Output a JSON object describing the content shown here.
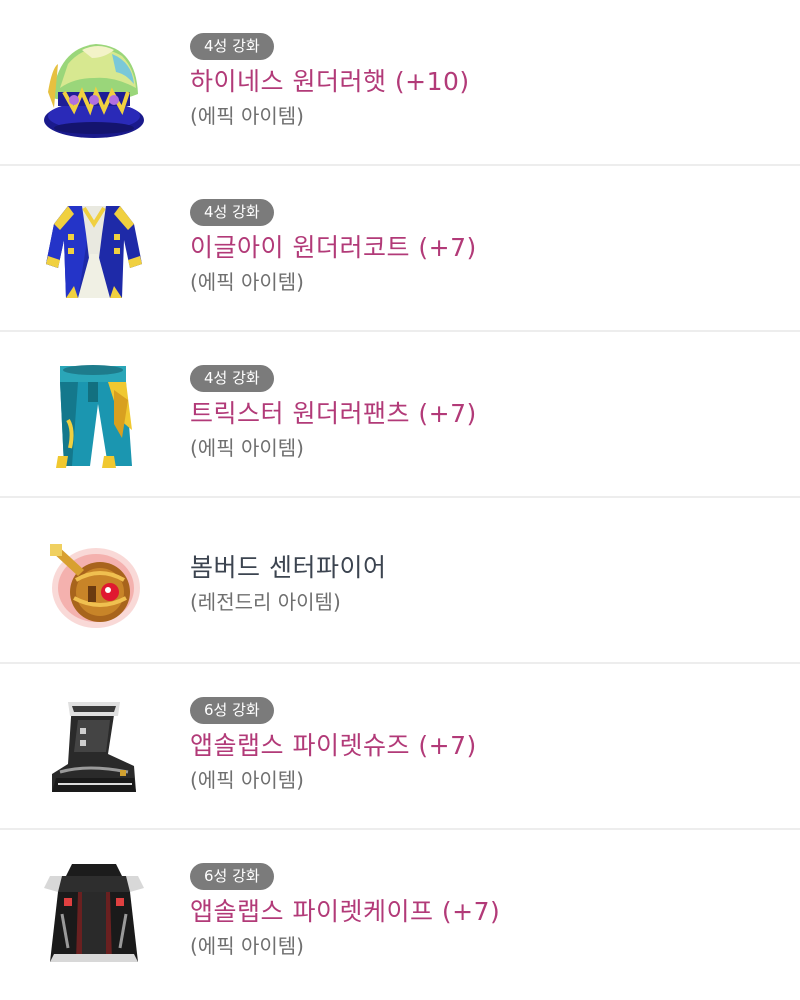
{
  "items": [
    {
      "icon": "wonder-hat-icon",
      "badge": "4성 강화",
      "name": "하이네스 원더러햇 (+10)",
      "grade": "(에픽 아이템)",
      "name_color": "#b23a78"
    },
    {
      "icon": "wonder-coat-icon",
      "badge": "4성 강화",
      "name": "이글아이 원더러코트 (+7)",
      "grade": "(에픽 아이템)",
      "name_color": "#b23a78"
    },
    {
      "icon": "wonder-pants-icon",
      "badge": "4성 강화",
      "name": "트릭스터 원더러팬츠 (+7)",
      "grade": "(에픽 아이템)",
      "name_color": "#b23a78"
    },
    {
      "icon": "bomb-pendant-icon",
      "badge": "",
      "name": "봄버드 센터파이어",
      "grade": "(레전드리 아이템)",
      "name_color": "#3c4450"
    },
    {
      "icon": "pirate-shoes-icon",
      "badge": "6성 강화",
      "name": "앱솔랩스 파이렛슈즈 (+7)",
      "grade": "(에픽 아이템)",
      "name_color": "#b23a78"
    },
    {
      "icon": "pirate-cape-icon",
      "badge": "6성 강화",
      "name": "앱솔랩스 파이렛케이프 (+7)",
      "grade": "(에픽 아이템)",
      "name_color": "#b23a78"
    }
  ],
  "colors": {
    "badge_bg": "#7b7b7b",
    "epic_name": "#b23a78",
    "legendary_name": "#3c4450",
    "grade_text": "#6f6f6f",
    "divider": "#ededed"
  }
}
